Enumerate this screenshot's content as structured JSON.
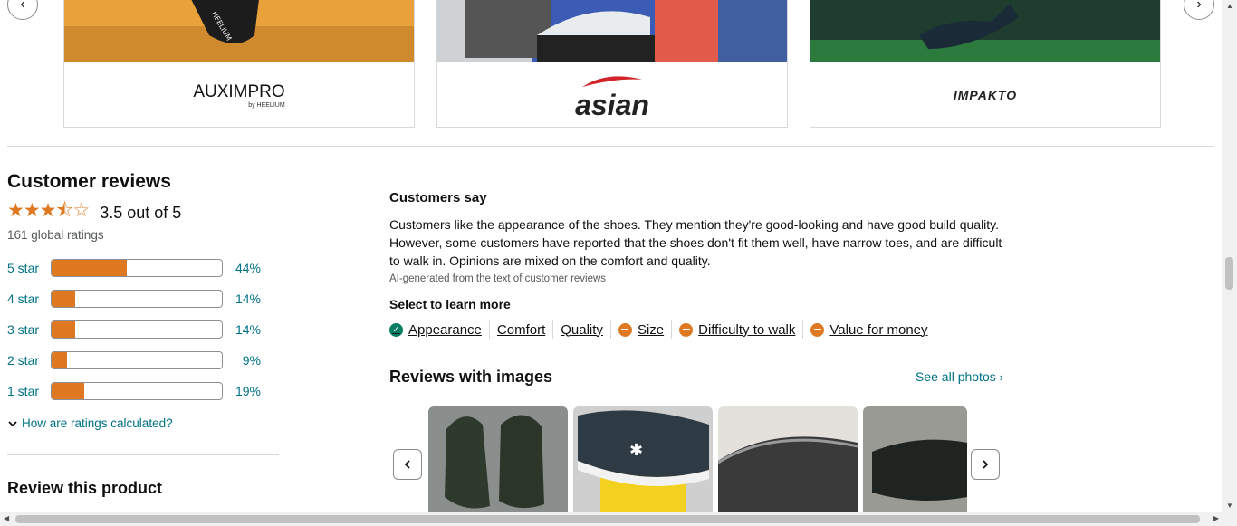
{
  "brands": {
    "prev_glyph": "‹",
    "next_glyph": "›",
    "cards": [
      {
        "logo": "AUXIMPRO",
        "sub": "by HEELIUM",
        "shoe_text": "HEELIUM"
      },
      {
        "logo": "asian"
      },
      {
        "logo": "IMPAKTO"
      }
    ]
  },
  "reviews": {
    "title": "Customer reviews",
    "stars_glyph": "★★★⯪☆",
    "rating_text": "3.5 out of 5",
    "global_ratings": "161 global ratings",
    "histogram": [
      {
        "label": "5 star",
        "pct_text": "44%",
        "pct": 44
      },
      {
        "label": "4 star",
        "pct_text": "14%",
        "pct": 14
      },
      {
        "label": "3 star",
        "pct_text": "14%",
        "pct": 14
      },
      {
        "label": "2 star",
        "pct_text": "9%",
        "pct": 9
      },
      {
        "label": "1 star",
        "pct_text": "19%",
        "pct": 19
      }
    ],
    "how_calc": "How are ratings calculated?",
    "review_product": "Review this product"
  },
  "customers_say": {
    "title": "Customers say",
    "body": "Customers like the appearance of the shoes. They mention they're good-looking and have good build quality. However, some customers have reported that the shoes don't fit them well, have narrow toes, and are difficult to walk in. Opinions are mixed on the comfort and quality.",
    "ai_note": "AI-generated from the text of customer reviews",
    "select_title": "Select to learn more",
    "aspects": [
      {
        "label": "Appearance",
        "sentiment": "positive"
      },
      {
        "label": "Comfort",
        "sentiment": "none"
      },
      {
        "label": "Quality",
        "sentiment": "none"
      },
      {
        "label": "Size",
        "sentiment": "mixed"
      },
      {
        "label": "Difficulty to walk",
        "sentiment": "mixed"
      },
      {
        "label": "Value for money",
        "sentiment": "mixed"
      }
    ]
  },
  "images": {
    "title": "Reviews with images",
    "see_all": "See all photos"
  },
  "colors": {
    "accent": "#de7921",
    "link": "#007185",
    "positive": "#067d62"
  }
}
